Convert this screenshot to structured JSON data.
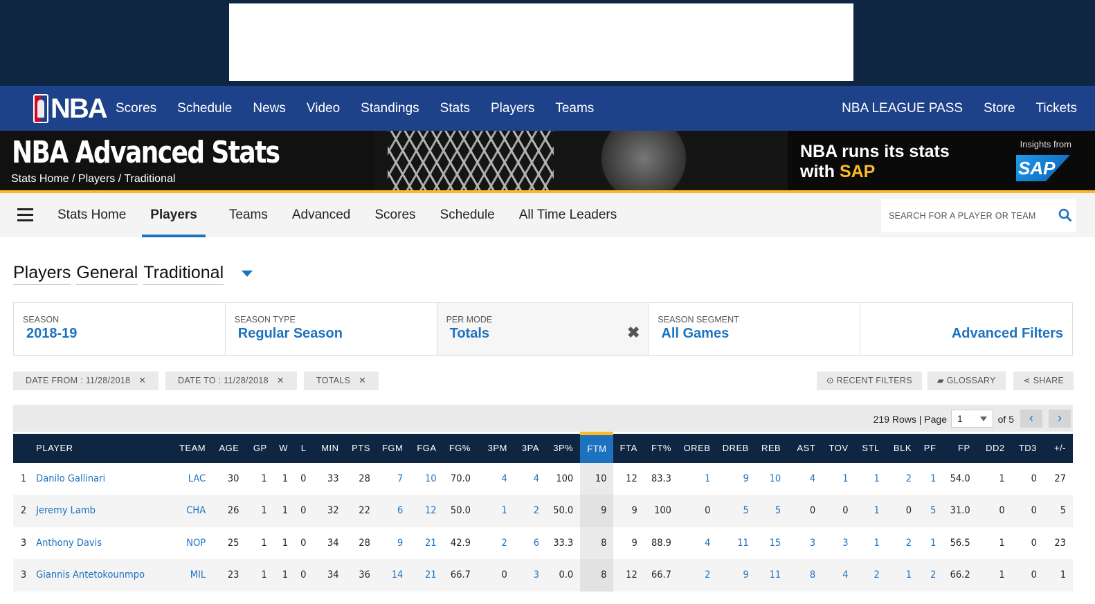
{
  "global_nav": {
    "logo_text": "NBA",
    "links": [
      "Scores",
      "Schedule",
      "News",
      "Video",
      "Standings",
      "Stats",
      "Players",
      "Teams"
    ],
    "right_links": [
      "NBA LEAGUE PASS",
      "Store",
      "Tickets"
    ]
  },
  "banner": {
    "title": "NBA Advanced Stats",
    "breadcrumb": "Stats Home / Players / Traditional",
    "sap_line1": "NBA runs its stats",
    "sap_line2_prefix": "with ",
    "sap_line2_brand": "SAP",
    "insights": "Insights from",
    "sap_logo": "SAP"
  },
  "stats_nav": {
    "items": [
      "Stats Home",
      "Players",
      "Teams",
      "Advanced",
      "Scores",
      "Schedule",
      "All Time Leaders"
    ],
    "active": "Players",
    "search_placeholder": "SEARCH FOR A PLAYER OR TEAM"
  },
  "page_title": {
    "w1": "Players",
    "w2": "General",
    "w3": "Traditional"
  },
  "filters": [
    {
      "label": "SEASON",
      "value": "2018-19"
    },
    {
      "label": "SEASON TYPE",
      "value": "Regular Season"
    },
    {
      "label": "PER MODE",
      "value": "Totals"
    },
    {
      "label": "SEASON SEGMENT",
      "value": "All Games"
    }
  ],
  "advanced_filters": "Advanced Filters",
  "chips": [
    "DATE FROM : 11/28/2018",
    "DATE TO : 11/28/2018",
    "TOTALS"
  ],
  "tools": {
    "recent": "RECENT FILTERS",
    "glossary": "GLOSSARY",
    "share": "SHARE"
  },
  "pager": {
    "rows_text": "219 Rows | Page",
    "page": "1",
    "of_text": "of 5"
  },
  "table": {
    "headers": [
      "",
      "PLAYER",
      "TEAM",
      "AGE",
      "GP",
      "W",
      "L",
      "MIN",
      "PTS",
      "FGM",
      "FGA",
      "FG%",
      "3PM",
      "3PA",
      "3P%",
      "FTM",
      "FTA",
      "FT%",
      "OREB",
      "DREB",
      "REB",
      "AST",
      "TOV",
      "STL",
      "BLK",
      "PF",
      "FP",
      "DD2",
      "TD3",
      "+/-"
    ],
    "rows": [
      [
        "1",
        "Danilo Gallinari",
        "LAC",
        "30",
        "1",
        "1",
        "0",
        "33",
        "28",
        "7",
        "10",
        "70.0",
        "4",
        "4",
        "100",
        "10",
        "12",
        "83.3",
        "1",
        "9",
        "10",
        "4",
        "1",
        "1",
        "2",
        "1",
        "54.0",
        "1",
        "0",
        "27"
      ],
      [
        "2",
        "Jeremy Lamb",
        "CHA",
        "26",
        "1",
        "1",
        "0",
        "32",
        "22",
        "6",
        "12",
        "50.0",
        "1",
        "2",
        "50.0",
        "9",
        "9",
        "100",
        "0",
        "5",
        "5",
        "0",
        "0",
        "1",
        "0",
        "5",
        "31.0",
        "0",
        "0",
        "5"
      ],
      [
        "3",
        "Anthony Davis",
        "NOP",
        "25",
        "1",
        "1",
        "0",
        "34",
        "28",
        "9",
        "21",
        "42.9",
        "2",
        "6",
        "33.3",
        "8",
        "9",
        "88.9",
        "4",
        "11",
        "15",
        "3",
        "3",
        "1",
        "2",
        "1",
        "56.5",
        "1",
        "0",
        "23"
      ],
      [
        "3",
        "Giannis Antetokounmpo",
        "MIL",
        "23",
        "1",
        "1",
        "0",
        "34",
        "36",
        "14",
        "21",
        "66.7",
        "0",
        "3",
        "0.0",
        "8",
        "12",
        "66.7",
        "2",
        "9",
        "11",
        "8",
        "4",
        "2",
        "1",
        "2",
        "66.2",
        "1",
        "0",
        "1"
      ]
    ]
  },
  "colors": {
    "nav_blue": "#1d428a",
    "dark_navy": "#0f2642",
    "link_blue": "#1d72c0",
    "gold": "#fdb927"
  }
}
